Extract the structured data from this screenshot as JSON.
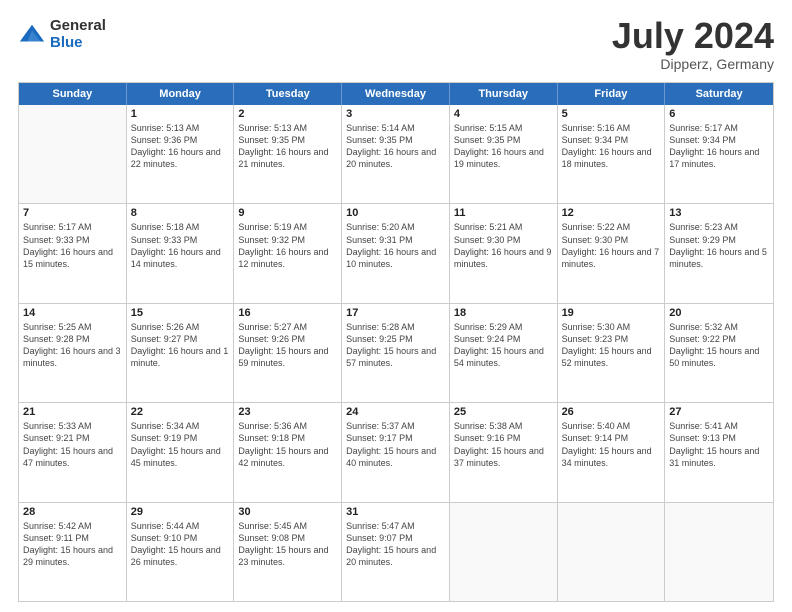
{
  "logo": {
    "general": "General",
    "blue": "Blue"
  },
  "header": {
    "month": "July 2024",
    "location": "Dipperz, Germany"
  },
  "weekdays": [
    "Sunday",
    "Monday",
    "Tuesday",
    "Wednesday",
    "Thursday",
    "Friday",
    "Saturday"
  ],
  "rows": [
    [
      {
        "empty": true
      },
      {
        "day": 1,
        "sr": "Sunrise: 5:13 AM",
        "ss": "Sunset: 9:36 PM",
        "dl": "Daylight: 16 hours and 22 minutes."
      },
      {
        "day": 2,
        "sr": "Sunrise: 5:13 AM",
        "ss": "Sunset: 9:35 PM",
        "dl": "Daylight: 16 hours and 21 minutes."
      },
      {
        "day": 3,
        "sr": "Sunrise: 5:14 AM",
        "ss": "Sunset: 9:35 PM",
        "dl": "Daylight: 16 hours and 20 minutes."
      },
      {
        "day": 4,
        "sr": "Sunrise: 5:15 AM",
        "ss": "Sunset: 9:35 PM",
        "dl": "Daylight: 16 hours and 19 minutes."
      },
      {
        "day": 5,
        "sr": "Sunrise: 5:16 AM",
        "ss": "Sunset: 9:34 PM",
        "dl": "Daylight: 16 hours and 18 minutes."
      },
      {
        "day": 6,
        "sr": "Sunrise: 5:17 AM",
        "ss": "Sunset: 9:34 PM",
        "dl": "Daylight: 16 hours and 17 minutes."
      }
    ],
    [
      {
        "day": 7,
        "sr": "Sunrise: 5:17 AM",
        "ss": "Sunset: 9:33 PM",
        "dl": "Daylight: 16 hours and 15 minutes."
      },
      {
        "day": 8,
        "sr": "Sunrise: 5:18 AM",
        "ss": "Sunset: 9:33 PM",
        "dl": "Daylight: 16 hours and 14 minutes."
      },
      {
        "day": 9,
        "sr": "Sunrise: 5:19 AM",
        "ss": "Sunset: 9:32 PM",
        "dl": "Daylight: 16 hours and 12 minutes."
      },
      {
        "day": 10,
        "sr": "Sunrise: 5:20 AM",
        "ss": "Sunset: 9:31 PM",
        "dl": "Daylight: 16 hours and 10 minutes."
      },
      {
        "day": 11,
        "sr": "Sunrise: 5:21 AM",
        "ss": "Sunset: 9:30 PM",
        "dl": "Daylight: 16 hours and 9 minutes."
      },
      {
        "day": 12,
        "sr": "Sunrise: 5:22 AM",
        "ss": "Sunset: 9:30 PM",
        "dl": "Daylight: 16 hours and 7 minutes."
      },
      {
        "day": 13,
        "sr": "Sunrise: 5:23 AM",
        "ss": "Sunset: 9:29 PM",
        "dl": "Daylight: 16 hours and 5 minutes."
      }
    ],
    [
      {
        "day": 14,
        "sr": "Sunrise: 5:25 AM",
        "ss": "Sunset: 9:28 PM",
        "dl": "Daylight: 16 hours and 3 minutes."
      },
      {
        "day": 15,
        "sr": "Sunrise: 5:26 AM",
        "ss": "Sunset: 9:27 PM",
        "dl": "Daylight: 16 hours and 1 minute."
      },
      {
        "day": 16,
        "sr": "Sunrise: 5:27 AM",
        "ss": "Sunset: 9:26 PM",
        "dl": "Daylight: 15 hours and 59 minutes."
      },
      {
        "day": 17,
        "sr": "Sunrise: 5:28 AM",
        "ss": "Sunset: 9:25 PM",
        "dl": "Daylight: 15 hours and 57 minutes."
      },
      {
        "day": 18,
        "sr": "Sunrise: 5:29 AM",
        "ss": "Sunset: 9:24 PM",
        "dl": "Daylight: 15 hours and 54 minutes."
      },
      {
        "day": 19,
        "sr": "Sunrise: 5:30 AM",
        "ss": "Sunset: 9:23 PM",
        "dl": "Daylight: 15 hours and 52 minutes."
      },
      {
        "day": 20,
        "sr": "Sunrise: 5:32 AM",
        "ss": "Sunset: 9:22 PM",
        "dl": "Daylight: 15 hours and 50 minutes."
      }
    ],
    [
      {
        "day": 21,
        "sr": "Sunrise: 5:33 AM",
        "ss": "Sunset: 9:21 PM",
        "dl": "Daylight: 15 hours and 47 minutes."
      },
      {
        "day": 22,
        "sr": "Sunrise: 5:34 AM",
        "ss": "Sunset: 9:19 PM",
        "dl": "Daylight: 15 hours and 45 minutes."
      },
      {
        "day": 23,
        "sr": "Sunrise: 5:36 AM",
        "ss": "Sunset: 9:18 PM",
        "dl": "Daylight: 15 hours and 42 minutes."
      },
      {
        "day": 24,
        "sr": "Sunrise: 5:37 AM",
        "ss": "Sunset: 9:17 PM",
        "dl": "Daylight: 15 hours and 40 minutes."
      },
      {
        "day": 25,
        "sr": "Sunrise: 5:38 AM",
        "ss": "Sunset: 9:16 PM",
        "dl": "Daylight: 15 hours and 37 minutes."
      },
      {
        "day": 26,
        "sr": "Sunrise: 5:40 AM",
        "ss": "Sunset: 9:14 PM",
        "dl": "Daylight: 15 hours and 34 minutes."
      },
      {
        "day": 27,
        "sr": "Sunrise: 5:41 AM",
        "ss": "Sunset: 9:13 PM",
        "dl": "Daylight: 15 hours and 31 minutes."
      }
    ],
    [
      {
        "day": 28,
        "sr": "Sunrise: 5:42 AM",
        "ss": "Sunset: 9:11 PM",
        "dl": "Daylight: 15 hours and 29 minutes."
      },
      {
        "day": 29,
        "sr": "Sunrise: 5:44 AM",
        "ss": "Sunset: 9:10 PM",
        "dl": "Daylight: 15 hours and 26 minutes."
      },
      {
        "day": 30,
        "sr": "Sunrise: 5:45 AM",
        "ss": "Sunset: 9:08 PM",
        "dl": "Daylight: 15 hours and 23 minutes."
      },
      {
        "day": 31,
        "sr": "Sunrise: 5:47 AM",
        "ss": "Sunset: 9:07 PM",
        "dl": "Daylight: 15 hours and 20 minutes."
      },
      {
        "empty": true
      },
      {
        "empty": true
      },
      {
        "empty": true
      }
    ]
  ]
}
